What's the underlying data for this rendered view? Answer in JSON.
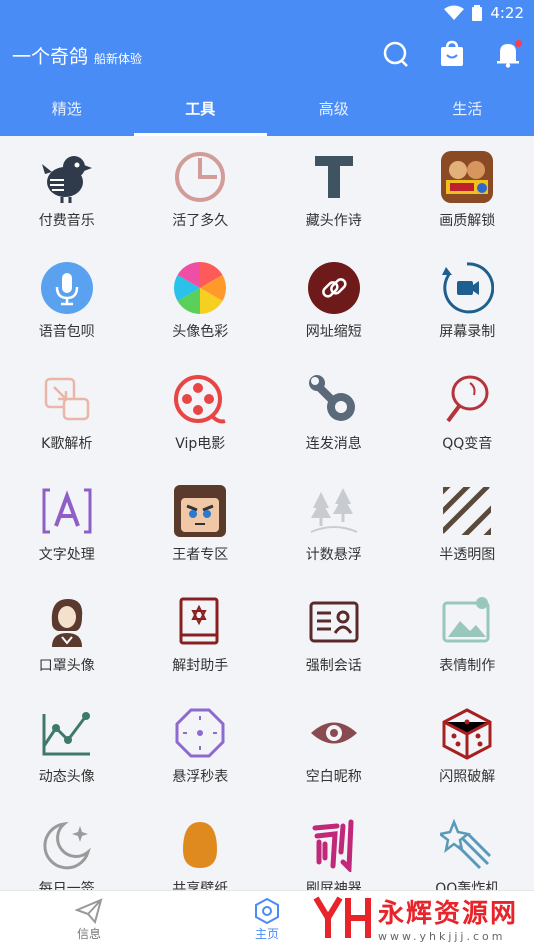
{
  "status_bar": {
    "time": "4:22",
    "icons": [
      "wifi-icon",
      "battery-icon"
    ]
  },
  "app_bar": {
    "title": "一个奇鸽",
    "subtitle": "船新体验",
    "actions": [
      "search-icon",
      "shop-bag-icon",
      "bell-icon"
    ],
    "accent_color": "#4a8cf6"
  },
  "tabs": [
    {
      "label": "精选",
      "active": false
    },
    {
      "label": "工具",
      "active": true
    },
    {
      "label": "高级",
      "active": false
    },
    {
      "label": "生活",
      "active": false
    }
  ],
  "tools": [
    {
      "label": "付费音乐",
      "icon": "bird-icon"
    },
    {
      "label": "活了多久",
      "icon": "pie-clock-icon"
    },
    {
      "label": "藏头作诗",
      "icon": "letter-t-icon"
    },
    {
      "label": "画质解锁",
      "icon": "game-poster-icon"
    },
    {
      "label": "语音包呗",
      "icon": "microphone-icon"
    },
    {
      "label": "头像色彩",
      "icon": "color-wheel-icon"
    },
    {
      "label": "网址缩短",
      "icon": "link-icon"
    },
    {
      "label": "屏幕录制",
      "icon": "screen-record-icon"
    },
    {
      "label": "K歌解析",
      "icon": "resize-icon"
    },
    {
      "label": "Vip电影",
      "icon": "film-reel-icon"
    },
    {
      "label": "连发消息",
      "icon": "wrench-gear-icon"
    },
    {
      "label": "QQ变音",
      "icon": "racket-icon"
    },
    {
      "label": "文字处理",
      "icon": "text-frame-icon"
    },
    {
      "label": "王者专区",
      "icon": "hero-avatar-icon"
    },
    {
      "label": "计数悬浮",
      "icon": "trees-icon"
    },
    {
      "label": "半透明图",
      "icon": "stripes-icon"
    },
    {
      "label": "口罩头像",
      "icon": "woman-avatar-icon"
    },
    {
      "label": "解封助手",
      "icon": "book-star-icon"
    },
    {
      "label": "强制会话",
      "icon": "id-card-icon"
    },
    {
      "label": "表情制作",
      "icon": "image-icon"
    },
    {
      "label": "动态头像",
      "icon": "line-chart-icon"
    },
    {
      "label": "悬浮秒表",
      "icon": "octagon-clock-icon"
    },
    {
      "label": "空白昵称",
      "icon": "eye-icon"
    },
    {
      "label": "闪照破解",
      "icon": "dice-icon"
    },
    {
      "label": "每日一签",
      "icon": "moon-icon"
    },
    {
      "label": "共享壁纸",
      "icon": "egg-icon"
    },
    {
      "label": "刷屏神器",
      "icon": "brush-char-icon"
    },
    {
      "label": "QQ轰炸机",
      "icon": "comet-icon"
    }
  ],
  "bottom_nav": [
    {
      "label": "信息",
      "icon": "paper-plane-icon",
      "active": false
    },
    {
      "label": "主页",
      "icon": "hexagon-icon",
      "active": true
    }
  ],
  "watermark": {
    "title": "永辉资源网",
    "url": "www.yhkjjj.com"
  }
}
